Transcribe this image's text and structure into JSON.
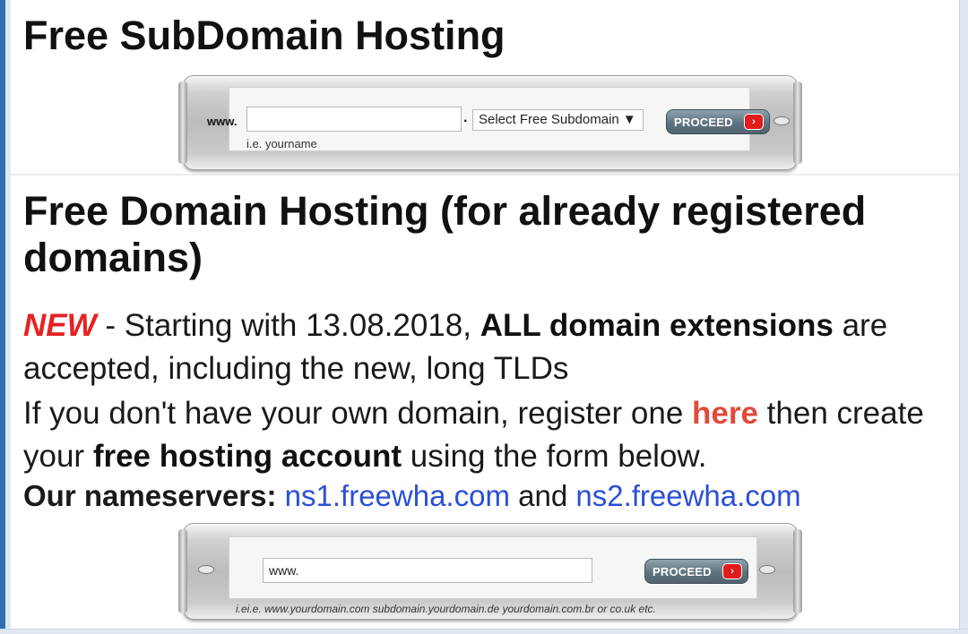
{
  "subdomain_section": {
    "title": "Free SubDomain Hosting",
    "www_label": "www.",
    "input_value": "",
    "dot": ".",
    "select_label": "Select Free Subdomain ▼",
    "hint": "i.e. yourname",
    "proceed_label": "PROCEED",
    "arrow_icon": "›"
  },
  "domain_section": {
    "title": "Free Domain Hosting (for already registered domains)",
    "notice": {
      "new_tag": "NEW",
      "text_1": " - Starting with 13.08.2018, ",
      "bold": "ALL domain extensions",
      "text_2": " are accepted, including the new, long TLDs"
    },
    "register": {
      "text_1": "If you don't have your own domain, register one ",
      "link": "here",
      "text_2": " then create your ",
      "bold": "free hosting account",
      "text_3": " using the form below."
    },
    "nameservers": {
      "label": "Our nameservers: ",
      "ns1": "ns1.freewha.com",
      "and": " and ",
      "ns2": "ns2.freewha.com"
    },
    "form": {
      "input_value": "www.",
      "proceed_label": "PROCEED",
      "arrow_icon": "›",
      "hint": "i.ei.e. www.yourdomain.com subdomain.yourdomain.de yourdomain.com.br or co.uk etc."
    }
  },
  "colors": {
    "new_tag": "#e52222",
    "here_link": "#e14a3b",
    "ns_link": "#2a4fd8",
    "proceed_button": "#5f7480",
    "proceed_arrow": "#e21b1b"
  }
}
